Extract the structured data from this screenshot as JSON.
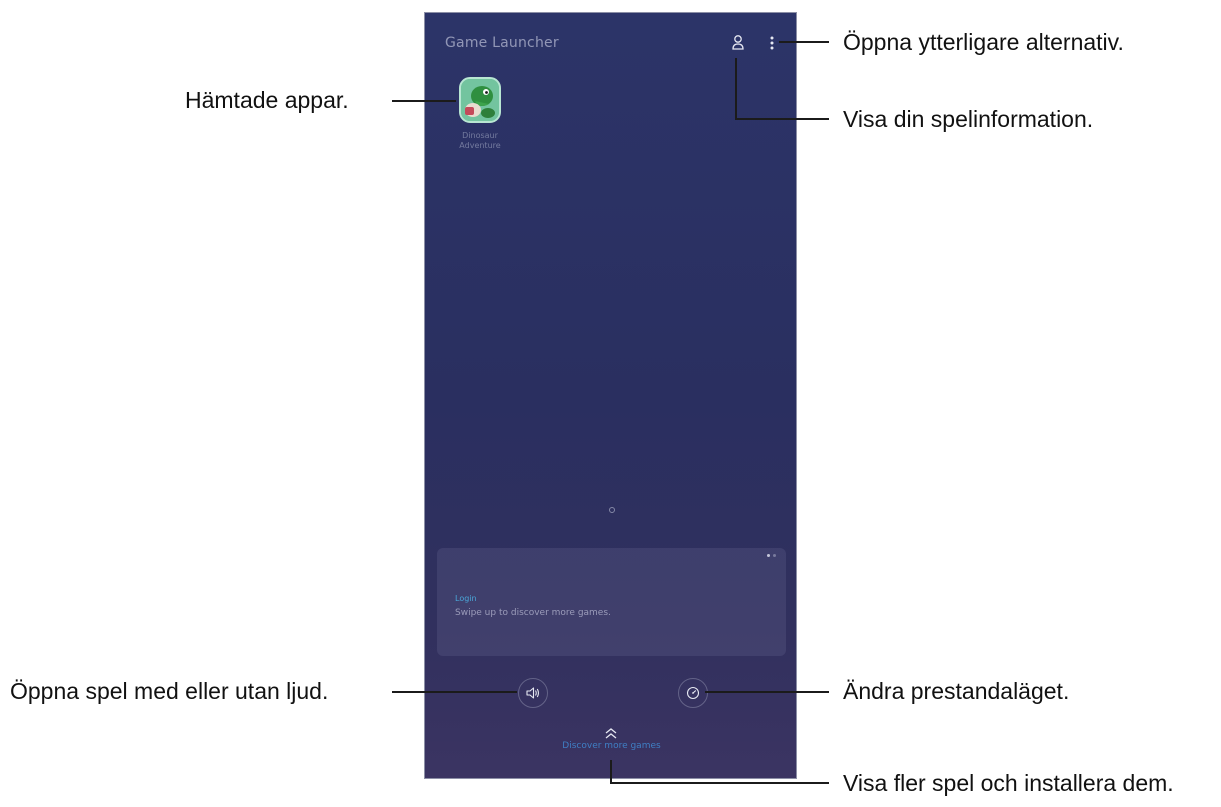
{
  "screen": {
    "app_title": "Game Launcher",
    "app_tile_label": "Dinosaur Adventure",
    "card_label": "Login",
    "card_text": "Swipe up to discover more games.",
    "discover_label": "Discover more games"
  },
  "callouts": {
    "more_options": "Öppna ytterligare alternativ.",
    "profile": "Visa din spelinformation.",
    "downloaded_apps": "Hämtade appar.",
    "sound": "Öppna spel med eller utan ljud.",
    "performance": "Ändra prestandaläget.",
    "discover": "Visa fler spel och installera dem."
  },
  "icons": {
    "profile": "profile-icon",
    "more": "more-options-icon",
    "sound": "speaker-icon",
    "performance": "performance-mode-icon",
    "chevron": "double-chevron-up-icon"
  },
  "colors": {
    "screen_background": "#2c3468",
    "card_label": "#4aa6d8",
    "discover_link": "#3f7fc4"
  }
}
